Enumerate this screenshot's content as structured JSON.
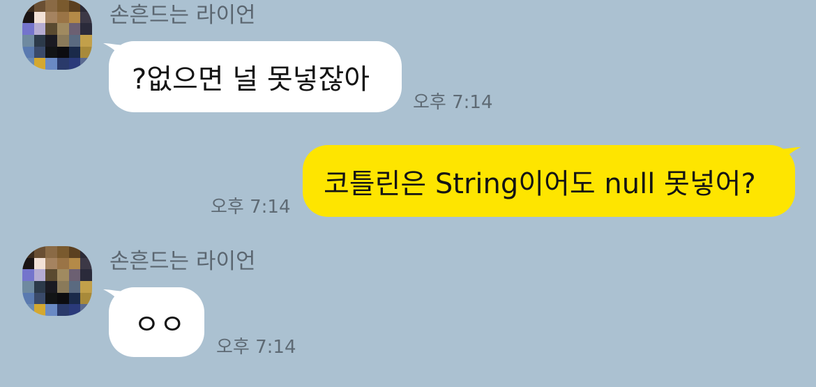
{
  "chat": {
    "messages": [
      {
        "direction": "incoming",
        "sender": "손흔드는 라이언",
        "text": "?없으면 널 못넣잖아",
        "time": "오후 7:14"
      },
      {
        "direction": "outgoing",
        "text": "코틀린은 String이어도 null 못넣어?",
        "time": "오후 7:14"
      },
      {
        "direction": "incoming",
        "sender": "손흔드는 라이언",
        "text": "ㅇㅇ",
        "time": "오후 7:14"
      }
    ]
  },
  "colors": {
    "background": "#abc1d1",
    "incoming_bubble": "#ffffff",
    "outgoing_bubble": "#fee500",
    "sender_name": "#5b6670",
    "timestamp": "#5e6a74"
  },
  "avatar": {
    "icon": "pixelated-profile-image",
    "pixels": [
      "#3a2a1c",
      "#6a4f33",
      "#8a6a45",
      "#7a5a2e",
      "#5b4020",
      "#2c2a36",
      "#1a1414",
      "#f2e1d6",
      "#a58360",
      "#9a7446",
      "#b48a48",
      "#3c3846",
      "#7474cc",
      "#b5acd2",
      "#5a4a30",
      "#a08a60",
      "#6c6072",
      "#2a2a3a",
      "#6f8aa0",
      "#2c3a4a",
      "#1a1a22",
      "#8a7a5a",
      "#5a6a80",
      "#c2a04a",
      "#5a7ab0",
      "#3a4a6a",
      "#121416",
      "#0c0c10",
      "#1a2a4a",
      "#a88a3a",
      "#6a8ab2",
      "#d4a830",
      "#6a8ac4",
      "#2a3a6a",
      "#2a3a7a",
      "#5a6a90"
    ]
  }
}
